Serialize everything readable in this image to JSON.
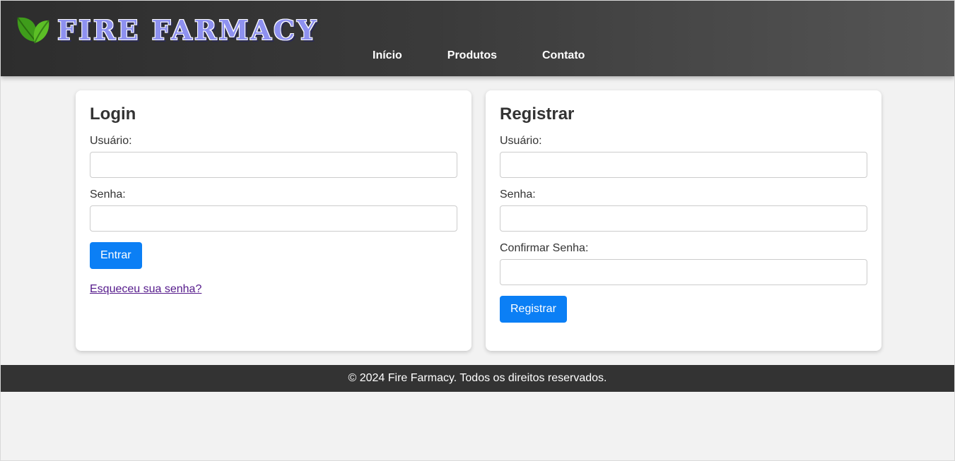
{
  "header": {
    "brand": "FIRE FARMACY",
    "logo_icon": "leaf-icon",
    "nav": [
      "Início",
      "Produtos",
      "Contato"
    ]
  },
  "login": {
    "title": "Login",
    "user_label": "Usuário:",
    "password_label": "Senha:",
    "submit_label": "Entrar",
    "forgot_link": "Esqueceu sua senha?"
  },
  "register": {
    "title": "Registrar",
    "user_label": "Usuário:",
    "password_label": "Senha:",
    "confirm_label": "Confirmar Senha:",
    "submit_label": "Registrar"
  },
  "footer": {
    "text": "© 2024 Fire Farmacy. Todos os direitos reservados."
  },
  "colors": {
    "brand_text": "#8e91f0",
    "leaf": "#4caf1f",
    "button": "#0b7ff5",
    "footer_bg": "#333333"
  }
}
